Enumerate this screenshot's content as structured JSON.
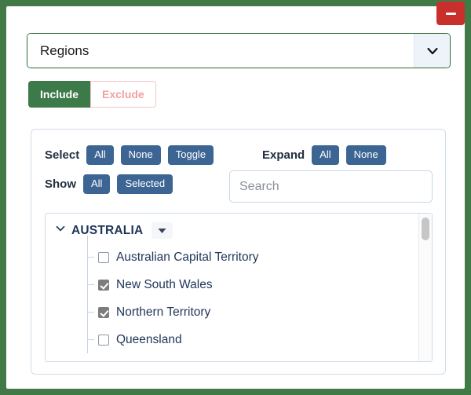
{
  "window": {
    "minimize_label": "minimize",
    "accent_green": "#417a47",
    "minimize_color": "#c9302c"
  },
  "dimension_select": {
    "value": "Regions",
    "caret_icon": "chevron-down-icon"
  },
  "mode_toggle": {
    "include_label": "Include",
    "exclude_label": "Exclude",
    "active": "Include",
    "include_color": "#3d7a4a",
    "exclude_color": "#f2a1a1"
  },
  "controls": {
    "select_label": "Select",
    "select_buttons": [
      "All",
      "None",
      "Toggle"
    ],
    "expand_label": "Expand",
    "expand_buttons": [
      "All",
      "None"
    ],
    "show_label": "Show",
    "show_buttons": [
      "All",
      "Selected"
    ],
    "button_color": "#3d6593"
  },
  "search": {
    "placeholder": "Search",
    "value": ""
  },
  "tree": {
    "group": {
      "name": "AUSTRALIA",
      "expanded": true,
      "chevron_icon": "chevron-down-icon",
      "menu_icon": "caret-down-icon"
    },
    "items": [
      {
        "label": "Australian Capital Territory",
        "checked": false
      },
      {
        "label": "New South Wales",
        "checked": true
      },
      {
        "label": "Northern Territory",
        "checked": true
      },
      {
        "label": "Queensland",
        "checked": false
      }
    ]
  },
  "scrollbar": {
    "orientation": "vertical",
    "position": "top"
  }
}
